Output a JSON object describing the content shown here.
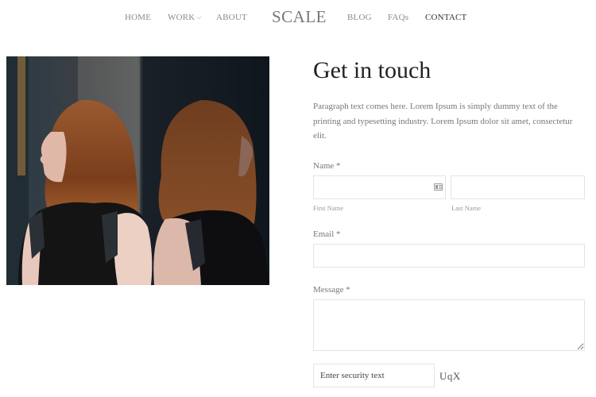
{
  "nav": {
    "left": [
      {
        "label": "HOME"
      },
      {
        "label": "WORK",
        "has_dropdown": true,
        "chevron": "⌵"
      },
      {
        "label": "ABOUT"
      }
    ],
    "logo": "SCALE",
    "right": [
      {
        "label": "BLOG"
      },
      {
        "label": "FAQs"
      },
      {
        "label": "CONTACT",
        "active": true
      }
    ]
  },
  "hero_image": {
    "description": "Woman with auburn hair in black top, leaning against a mirrored wall showing her reflection"
  },
  "contact": {
    "title": "Get in touch",
    "paragraph": "Paragraph text comes here. Lorem Ipsum is simply dummy text of the printing and typesetting industry. Lorem Ipsum dolor sit amet, consectetur elit.",
    "form": {
      "name_label": "Name *",
      "first_name": {
        "value": "",
        "sublabel": "First Name",
        "icon": "contact-card-icon"
      },
      "last_name": {
        "value": "",
        "sublabel": "Last Name"
      },
      "email_label": "Email *",
      "email": {
        "value": ""
      },
      "message_label": "Message *",
      "message": {
        "value": ""
      },
      "security": {
        "value": "",
        "placeholder": "Enter security text"
      },
      "captcha_text": "UqX"
    }
  },
  "colors": {
    "nav_text": "#8a8a8a",
    "nav_active": "#333333",
    "body_text": "#777777",
    "input_border": "#e4e4e4"
  }
}
